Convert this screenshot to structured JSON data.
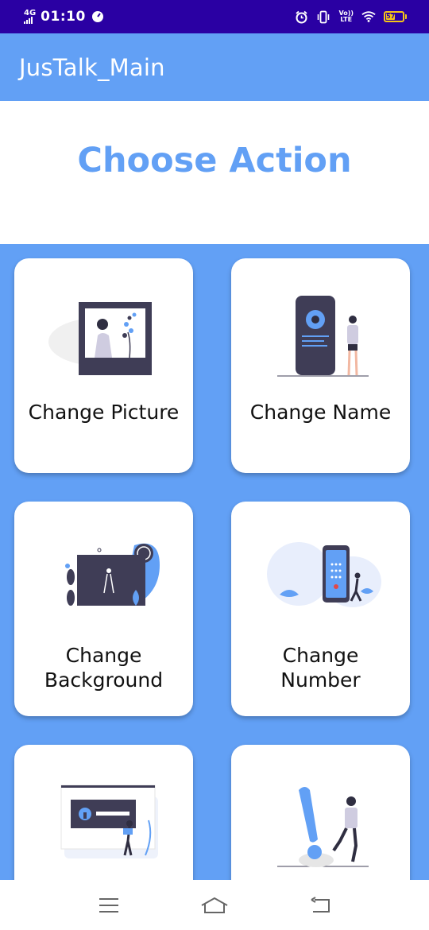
{
  "status_bar": {
    "network": "4G",
    "time": "01:10",
    "volte_top": "Vo))",
    "volte_bottom": "LTE",
    "battery": "57"
  },
  "app_bar": {
    "title": "JusTalk_Main"
  },
  "heading": "Choose Action",
  "actions": [
    {
      "label": "Change Picture",
      "icon": "picture-illustration-icon"
    },
    {
      "label": "Change Name",
      "icon": "name-illustration-icon"
    },
    {
      "label": "Change Background",
      "icon": "background-illustration-icon"
    },
    {
      "label": "Change Number",
      "icon": "number-illustration-icon"
    },
    {
      "label": "",
      "icon": "lock-illustration-icon"
    },
    {
      "label": "",
      "icon": "exclamation-illustration-icon"
    }
  ],
  "colors": {
    "status_bar": "#2a00a3",
    "primary": "#62a0f5",
    "dark": "#3f3d56",
    "card": "#ffffff"
  },
  "nav_icons": [
    "menu-icon",
    "home-icon",
    "back-icon"
  ]
}
